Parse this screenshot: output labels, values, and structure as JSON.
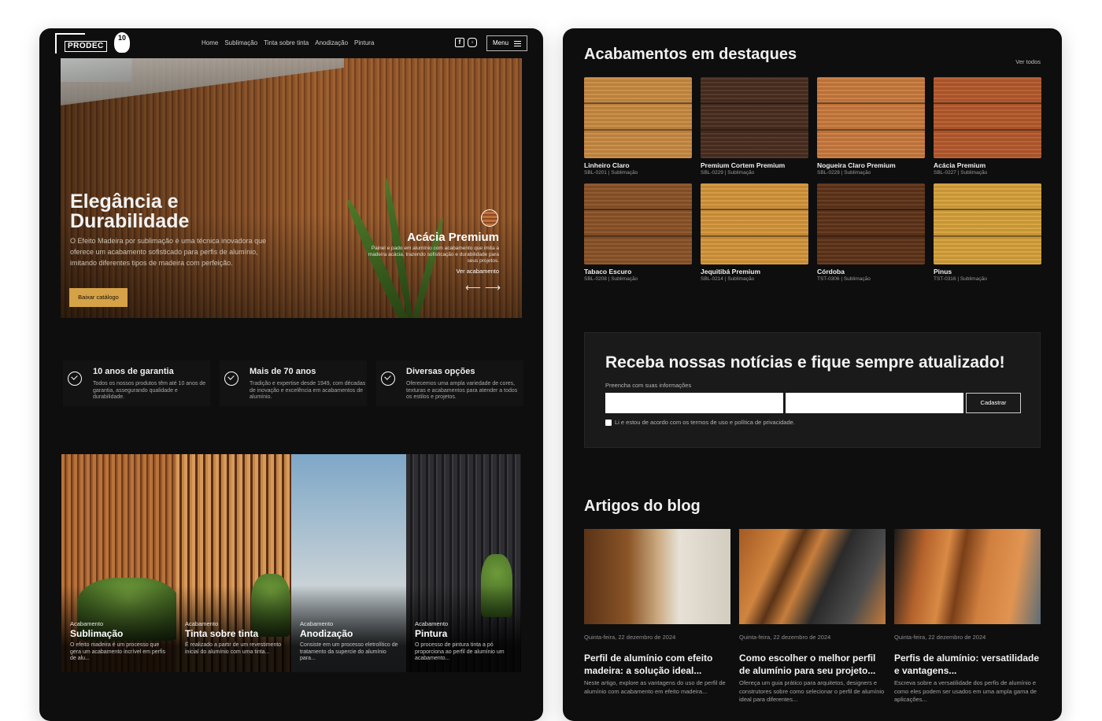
{
  "brand": {
    "logo_text": "PRODEC",
    "seal_text": "10"
  },
  "nav": {
    "items": [
      "Home",
      "Sublimação",
      "Tinta sobre tinta",
      "Anodização",
      "Pintura"
    ],
    "menu_label": "Menu"
  },
  "hero": {
    "title": "Elegância e Durabilidade",
    "description": "O Efeito Madeira por sublimação é uma técnica inovadora que oferece um acabamento sofisticado para perfis de alumínio, imitando diferentes tipos de madeira com perfeição.",
    "cta": "Baixar catálogo",
    "featured": {
      "name": "Acácia Premium",
      "description": "Painel e pado em alumínio com acabamento que imita a madeira acácia, trazendo sofisticação e durabilidade para seus projetos.",
      "link": "Ver acabamento"
    }
  },
  "benefits": [
    {
      "title": "10 anos de garantia",
      "desc": "Todos os nossos produtos têm até 10 anos de garantia, assegurando qualidade e durabilidade."
    },
    {
      "title": "Mais de 70 anos",
      "desc": "Tradição e expertise desde 1949, com décadas de inovação e excelência em acabamentos de alumínio."
    },
    {
      "title": "Diversas opções",
      "desc": "Oferecemos uma ampla variedade de cores, texturas e acabamentos para atender a todos os estilos e projetos."
    }
  ],
  "finishes": [
    {
      "label": "Acabamento",
      "name": "Sublimação",
      "desc": "O efeito madeira é um processo que gera um acabamento incrível em perfis de alu..."
    },
    {
      "label": "Acabamento",
      "name": "Tinta sobre tinta",
      "desc": "É realizado a partir de um revestimento inicial do alumínio com uma tinta..."
    },
    {
      "label": "Acabamento",
      "name": "Anodização",
      "desc": "Consiste em um processo eletrolítico de tratamento da supercie do alumínio para..."
    },
    {
      "label": "Acabamento",
      "name": "Pintura",
      "desc": "O processo de pintura tinta a pó proporciona ao perfil de alumínio um acabamento..."
    }
  ],
  "highlights": {
    "title": "Acabamentos em destaques",
    "see_all": "Ver todos",
    "items": [
      {
        "name": "Linheiro Claro",
        "code": "SBL-0201 | Sublimação",
        "color": "#c98a42"
      },
      {
        "name": "Premium Cortem Premium",
        "code": "SBL-0229 | Sublimação",
        "color": "#4a2e1f"
      },
      {
        "name": "Nogueira Claro Premium",
        "code": "SBL-0228 | Sublimação",
        "color": "#c97a3e"
      },
      {
        "name": "Acácia Premium",
        "code": "SBL-0227 | Sublimação",
        "color": "#b5592c"
      },
      {
        "name": "Tabaco Escuro",
        "code": "SBL-0208 | Sublimação",
        "color": "#8a5226"
      },
      {
        "name": "Jequitibá Premium",
        "code": "SBL-0214 | Sublimação",
        "color": "#d4953a"
      },
      {
        "name": "Córdoba",
        "code": "TST-0306 | Sublimação",
        "color": "#5e3218"
      },
      {
        "name": "Pinus",
        "code": "TST-0316 | Sublimação",
        "color": "#d6a13a"
      }
    ]
  },
  "newsletter": {
    "title": "Receba nossas notícias e fique sempre atualizado!",
    "subtitle": "Preencha com suas informações",
    "submit": "Cadastrar",
    "terms": "Li e estou de acordo com os termos de uso e política de privacidade."
  },
  "blog": {
    "title": "Artigos do blog",
    "posts": [
      {
        "date": "Quinta-feira, 22 dezembro de 2024",
        "title": "Perfil de alumínio com efeito madeira: a solução ideal...",
        "excerpt": "Neste artigo, explore as vantagens do uso de perfil de alumínio com acabamento em efeito madeira..."
      },
      {
        "date": "Quinta-feira, 22 dezembro de 2024",
        "title": "Como escolher o melhor perfil de alumínio para seu projeto...",
        "excerpt": "Ofereça um guia prático para arquitetos, designers e construtores sobre como selecionar o perfil de alumínio ideal para diferentes..."
      },
      {
        "date": "Quinta-feira, 22 dezembro de 2024",
        "title": "Perfis de alumínio: versatilidade e vantagens...",
        "excerpt": "Escreva sobre a versatilidade dos perfis de alumínio e como eles podem ser usados em uma ampla gama de aplicações..."
      }
    ]
  }
}
